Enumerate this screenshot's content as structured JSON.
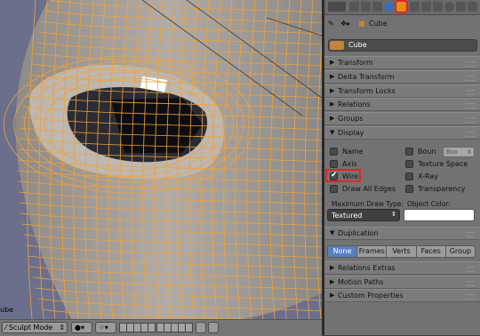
{
  "viewport": {
    "object_label": "ube",
    "colors": {
      "background": "#6b6f8c",
      "mesh": "#a49f9a",
      "wire": "#f0a23a"
    }
  },
  "bottom_bar": {
    "mode_label": "Sculpt Mode",
    "mode_icon": "sculpt-brush-icon"
  },
  "properties": {
    "header_tabs": [
      "render",
      "render-layers",
      "scene",
      "world",
      "object",
      "constraints",
      "modifiers",
      "data",
      "material",
      "texture",
      "particles",
      "physics"
    ],
    "active_tab": "object",
    "context": {
      "object_name": "Cube"
    },
    "name_field": "Cube",
    "sections": {
      "transform": "Transform",
      "delta_transform": "Delta Transform",
      "transform_locks": "Transform Locks",
      "relations": "Relations",
      "groups": "Groups",
      "display": "Display",
      "duplication": "Duplication",
      "relations_extras": "Relations Extras",
      "motion_paths": "Motion Paths",
      "custom_properties": "Custom Properties"
    },
    "display": {
      "name": "Name",
      "bounds": "Boun",
      "bounds_type": "Box",
      "axis": "Axis",
      "texture_space": "Texture Space",
      "wire": "Wire",
      "xray": "X-Ray",
      "draw_all_edges": "Draw All Edges",
      "transparency": "Transparency",
      "max_draw_type_label": "Maximum Draw Type:",
      "max_draw_type": "Textured",
      "object_color_label": "Object Color:",
      "object_color": "#ffffff",
      "wire_checked": true
    },
    "duplication": {
      "options": [
        "None",
        "Frames",
        "Verts",
        "Faces",
        "Group"
      ],
      "selected": "None"
    },
    "accent_color": "#e88c1a",
    "highlight_color": "#e0242a"
  }
}
